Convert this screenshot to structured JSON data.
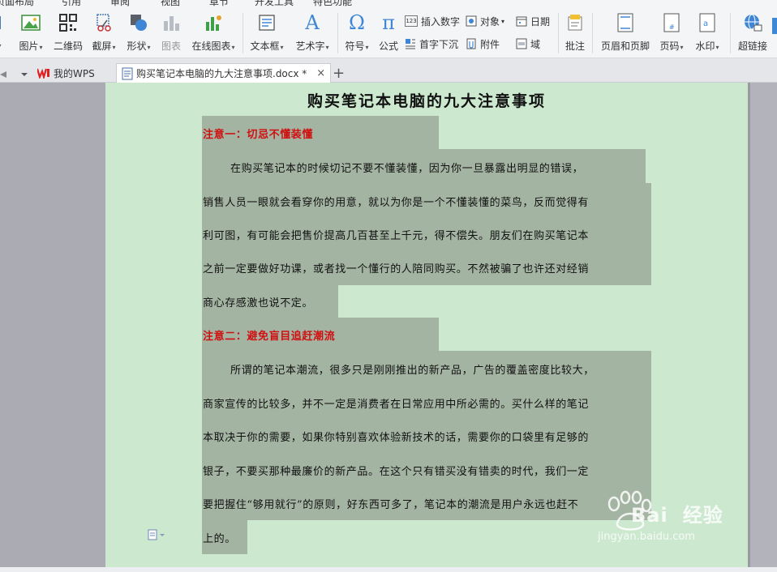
{
  "menu": {
    "items": [
      "页面布局",
      "引用",
      "审阅",
      "视图",
      "章节",
      "开发工具",
      "特色功能"
    ]
  },
  "ribbon": {
    "picture": "图片",
    "qrcode": "二维码",
    "screenshot": "截屏",
    "shape": "形状",
    "chart": "图表",
    "online_chart": "在线图表",
    "textbox": "文本框",
    "wordart": "艺术字",
    "symbol": "符号",
    "formula": "公式",
    "insert_number": "插入数字",
    "object": "对象",
    "date": "日期",
    "dropcap": "首字下沉",
    "attachment": "附件",
    "field": "域",
    "comment": "批注",
    "header_footer": "页眉和页脚",
    "page_number": "页码",
    "watermark": "水印",
    "hyperlink": "超链接",
    "number_badge": "123"
  },
  "tabs": {
    "home": "我的WPS",
    "doc": "购买笔记本电脑的九大注意事项.docx *",
    "close": "×",
    "new": "+"
  },
  "document": {
    "title": "购买笔记本电脑的九大注意事项",
    "heading1": "注意一：切忌不懂装懂",
    "p1": [
      "在购买笔记本的时候切记不要不懂装懂，因为你一旦暴露出明显的错误，",
      "销售人员一眼就会看穿你的用意，就以为你是一个不懂装懂的菜鸟，反而觉得有",
      "利可图，有可能会把售价提高几百甚至上千元，得不偿失。朋友们在购买笔记本",
      "之前一定要做好功课，或者找一个懂行的人陪同购买。不然被骗了也许还对经销",
      "商心存感激也说不定。"
    ],
    "heading2": "注意二：避免盲目追赶潮流",
    "p2": [
      "所谓的笔记本潮流，很多只是刚刚推出的新产品，广告的覆盖密度比较大，",
      "商家宣传的比较多，并不一定是消费者在日常应用中所必需的。买什么样的笔记",
      "本取决于你的需要，如果你特别喜欢体验新技术的话，需要你的口袋里有足够的",
      "银子，不要买那种最廉价的新产品。在这个只有错买没有错卖的时代，我们一定",
      "要把握住“够用就行”的原则，好东西可多了，笔记本的潮流是用户永远也赶不",
      "上的。"
    ]
  },
  "watermark": {
    "brand": "经验",
    "url": "jingyan.baidu.com",
    "logo_text": "Bai"
  },
  "colors": {
    "page_bg": "#cce8cf",
    "highlight": "#a4b4a2",
    "heading_red": "#d01010",
    "canvas": "#ababb3"
  }
}
